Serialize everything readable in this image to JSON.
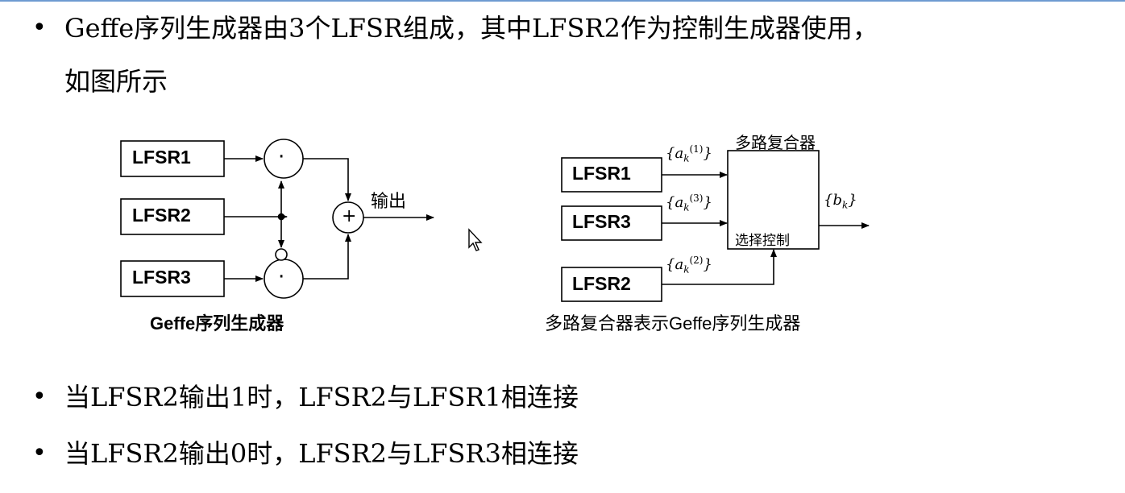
{
  "bullets": {
    "b1_line1": "Geffe序列生成器由3个LFSR组成，其中LFSR2作为控制生成器使用，",
    "b1_line2": "如图所示",
    "b2": "当LFSR2输出1时，LFSR2与LFSR1相连接",
    "b3": "当LFSR2输出0时，LFSR2与LFSR3相连接",
    "dot": "•"
  },
  "left_diagram": {
    "boxes": [
      "LFSR1",
      "LFSR2",
      "LFSR3"
    ],
    "and_symbol": "·",
    "xor_symbol": "+",
    "output_label": "输出",
    "caption": "Geffe序列生成器"
  },
  "right_diagram": {
    "boxes": [
      "LFSR1",
      "LFSR3",
      "LFSR2"
    ],
    "mux_title": "多路复合器",
    "mux_control": "选择控制",
    "seq_a1": "{a",
    "seq_a1_sub": "k",
    "seq_a1_sup": "(1)",
    "seq_a3_sup": "(3)",
    "seq_a2_sup": "(2)",
    "seq_close": "}",
    "output_seq": "{b",
    "output_sub": "k",
    "caption": "多路复合器表示Geffe序列生成器"
  }
}
